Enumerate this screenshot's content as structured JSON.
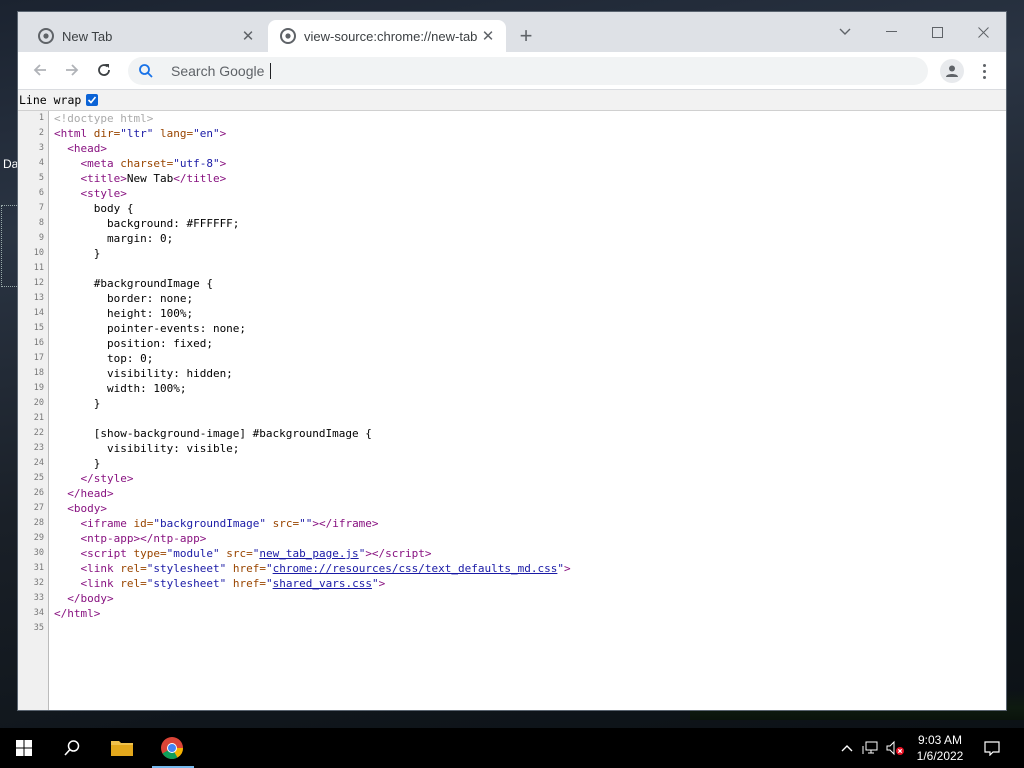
{
  "desktop": {
    "label": "Da"
  },
  "browser": {
    "tabs": [
      {
        "title": "New Tab",
        "favicon": "chrome-icon",
        "active": false
      },
      {
        "title": "view-source:chrome://new-tab-p",
        "favicon": "chrome-icon",
        "active": true
      }
    ],
    "omnibox": {
      "placeholder": "Search Google"
    }
  },
  "page": {
    "wrap_label": "Line wrap",
    "wrap_checked": true,
    "source_lines": [
      {
        "n": "1",
        "html": "<span class=\"comc\">&lt;!doctype html&gt;</span>"
      },
      {
        "n": "2",
        "html": "<span class=\"tagc\">&lt;html </span><span class=\"attrc\">dir=</span><span class=\"valc\">\"ltr\"</span> <span class=\"attrc\">lang=</span><span class=\"valc\">\"en\"</span><span class=\"tagc\">&gt;</span>"
      },
      {
        "n": "3",
        "html": "  <span class=\"tagc\">&lt;head&gt;</span>"
      },
      {
        "n": "4",
        "html": "    <span class=\"tagc\">&lt;meta </span><span class=\"attrc\">charset=</span><span class=\"valc\">\"utf-8\"</span><span class=\"tagc\">&gt;</span>"
      },
      {
        "n": "5",
        "html": "    <span class=\"tagc\">&lt;title&gt;</span>New Tab<span class=\"tagc\">&lt;/title&gt;</span>"
      },
      {
        "n": "6",
        "html": "    <span class=\"tagc\">&lt;style&gt;</span>"
      },
      {
        "n": "7",
        "html": "      body {"
      },
      {
        "n": "8",
        "html": "        background: #FFFFFF;"
      },
      {
        "n": "9",
        "html": "        margin: 0;"
      },
      {
        "n": "10",
        "html": "      }"
      },
      {
        "n": "11",
        "html": ""
      },
      {
        "n": "12",
        "html": "      #backgroundImage {"
      },
      {
        "n": "13",
        "html": "        border: none;"
      },
      {
        "n": "14",
        "html": "        height: 100%;"
      },
      {
        "n": "15",
        "html": "        pointer-events: none;"
      },
      {
        "n": "16",
        "html": "        position: fixed;"
      },
      {
        "n": "17",
        "html": "        top: 0;"
      },
      {
        "n": "18",
        "html": "        visibility: hidden;"
      },
      {
        "n": "19",
        "html": "        width: 100%;"
      },
      {
        "n": "20",
        "html": "      }"
      },
      {
        "n": "21",
        "html": ""
      },
      {
        "n": "22",
        "html": "      [show-background-image] #backgroundImage {"
      },
      {
        "n": "23",
        "html": "        visibility: visible;"
      },
      {
        "n": "24",
        "html": "      }"
      },
      {
        "n": "25",
        "html": "    <span class=\"tagc\">&lt;/style&gt;</span>"
      },
      {
        "n": "26",
        "html": "  <span class=\"tagc\">&lt;/head&gt;</span>"
      },
      {
        "n": "27",
        "html": "  <span class=\"tagc\">&lt;body&gt;</span>"
      },
      {
        "n": "28",
        "html": "    <span class=\"tagc\">&lt;iframe </span><span class=\"attrc\">id=</span><span class=\"valc\">\"backgroundImage\"</span> <span class=\"attrc\">src=</span><span class=\"valc\">\"\"</span><span class=\"tagc\">&gt;&lt;/iframe&gt;</span>"
      },
      {
        "n": "29",
        "html": "    <span class=\"tagc\">&lt;ntp-app&gt;&lt;/ntp-app&gt;</span>"
      },
      {
        "n": "30",
        "html": "    <span class=\"tagc\">&lt;script </span><span class=\"attrc\">type=</span><span class=\"valc\">\"module\"</span> <span class=\"attrc\">src=</span><span class=\"valc\">\"<span class=\"linkc\">new_tab_page.js</span>\"</span><span class=\"tagc\">&gt;&lt;/script&gt;</span>"
      },
      {
        "n": "31",
        "html": "    <span class=\"tagc\">&lt;link </span><span class=\"attrc\">rel=</span><span class=\"valc\">\"stylesheet\"</span> <span class=\"attrc\">href=</span><span class=\"valc\">\"<span class=\"linkc\">chrome://resources/css/text_defaults_md.css</span>\"</span><span class=\"tagc\">&gt;</span>"
      },
      {
        "n": "32",
        "html": "    <span class=\"tagc\">&lt;link </span><span class=\"attrc\">rel=</span><span class=\"valc\">\"stylesheet\"</span> <span class=\"attrc\">href=</span><span class=\"valc\">\"<span class=\"linkc\">shared_vars.css</span>\"</span><span class=\"tagc\">&gt;</span>"
      },
      {
        "n": "33",
        "html": "  <span class=\"tagc\">&lt;/body&gt;</span>"
      },
      {
        "n": "34",
        "html": "<span class=\"tagc\">&lt;/html&gt;</span>"
      },
      {
        "n": "35",
        "html": ""
      }
    ]
  },
  "taskbar": {
    "time": "9:03 AM",
    "date": "1/6/2022"
  },
  "colors": {
    "tag": "#881280",
    "attribute": "#994500",
    "value": "#1a1aa6",
    "comment": "#aaaaaa"
  }
}
